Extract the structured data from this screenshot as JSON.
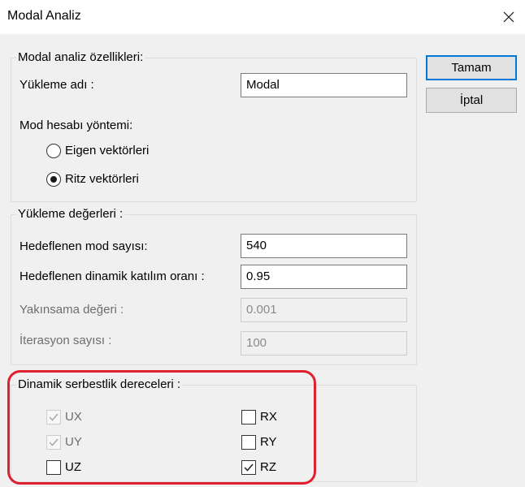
{
  "window": {
    "title": "Modal Analiz",
    "close_icon": "close-icon"
  },
  "buttons": {
    "ok_label": "Tamam",
    "cancel_label": "İptal"
  },
  "properties": {
    "legend": "Modal analiz özellikleri:",
    "load_name_label": "Yükleme adı :",
    "load_name_value": "Modal",
    "method_label": "Mod hesabı yöntemi:",
    "eigen_label": "Eigen vektörleri",
    "ritz_label": "Ritz vektörleri",
    "selected_method": "ritz"
  },
  "load_values": {
    "legend": "Yükleme değerleri :",
    "mode_count_label": "Hedeflenen mod sayısı:",
    "mode_count_value": "540",
    "mass_ratio_label": "Hedeflenen dinamik katılım oranı :",
    "mass_ratio_value": "0.95",
    "convergence_label": "Yakınsama değeri :",
    "convergence_value": "0.001",
    "iteration_label": "İterasyon sayısı :",
    "iteration_value": "100"
  },
  "dof": {
    "legend": "Dinamik serbestlik dereceleri :",
    "ux": {
      "label": "UX",
      "checked": true,
      "enabled": false
    },
    "uy": {
      "label": "UY",
      "checked": true,
      "enabled": false
    },
    "uz": {
      "label": "UZ",
      "checked": false,
      "enabled": true
    },
    "rx": {
      "label": "RX",
      "checked": false,
      "enabled": true
    },
    "ry": {
      "label": "RY",
      "checked": false,
      "enabled": true
    },
    "rz": {
      "label": "RZ",
      "checked": true,
      "enabled": true
    }
  },
  "colors": {
    "accent": "#0078d7",
    "highlight": "#e0202e"
  }
}
